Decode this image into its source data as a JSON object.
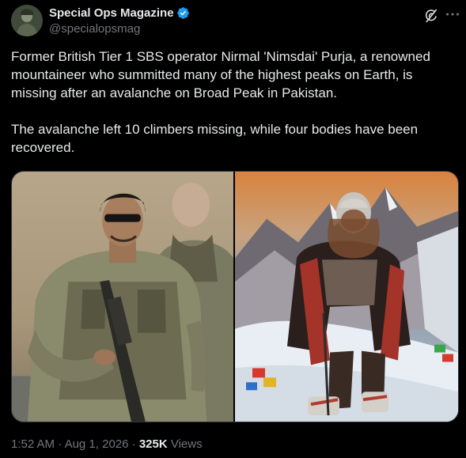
{
  "account": {
    "display_name": "Special Ops Magazine",
    "handle": "@specialopsmag",
    "verified": true
  },
  "icons": {
    "verified": "verified-badge-icon",
    "grok": "grok-icon",
    "more": "more-options-icon",
    "accent_color": "#1d9bf0"
  },
  "tweet": {
    "paragraphs": [
      "Former British Tier 1 SBS operator Nirmal 'Nimsdai' Purja, a renowned mountaineer who summitted many of the highest peaks on Earth, is missing after an avalanche on Broad Peak in Pakistan.",
      "The avalanche left 10 climbers missing, while four bodies have been recovered."
    ]
  },
  "media": {
    "count": 2
  },
  "meta": {
    "time": "1:52 AM",
    "separator": "·",
    "date": "Aug 1, 2026",
    "views_count": "325K",
    "views_label": "Views"
  }
}
